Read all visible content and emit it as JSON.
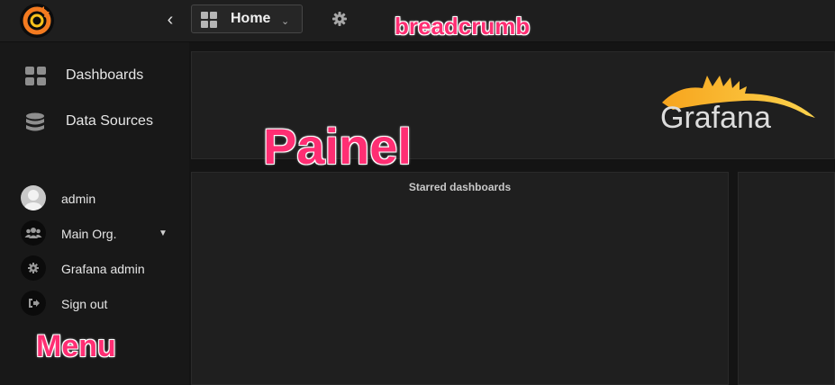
{
  "navbar": {
    "dashboard_title": "Home",
    "icons": [
      "grafana-logo-icon",
      "chevron-left-icon",
      "grid-icon",
      "caret-down-icon",
      "gear-icon"
    ]
  },
  "annotations": {
    "breadcrumb": "breadcrumb",
    "panel": "Painel",
    "menu": "Menu"
  },
  "sidebar": {
    "items": [
      {
        "label": "Dashboards",
        "icon": "dashboards-icon"
      },
      {
        "label": "Data Sources",
        "icon": "database-icon"
      }
    ],
    "user": [
      {
        "label": "admin",
        "icon": "avatar"
      },
      {
        "label": "Main Org.",
        "icon": "users-icon"
      },
      {
        "label": "Grafana admin",
        "icon": "gear-icon"
      },
      {
        "label": "Sign out",
        "icon": "sign-out-icon"
      }
    ]
  },
  "main": {
    "logo_text": "Grafana",
    "starred_title": "Starred dashboards"
  },
  "colors": {
    "background": "#141414",
    "panel": "#1f1f1f",
    "annotation": "#ff2e73",
    "logo_orange": "#f7a41d"
  }
}
